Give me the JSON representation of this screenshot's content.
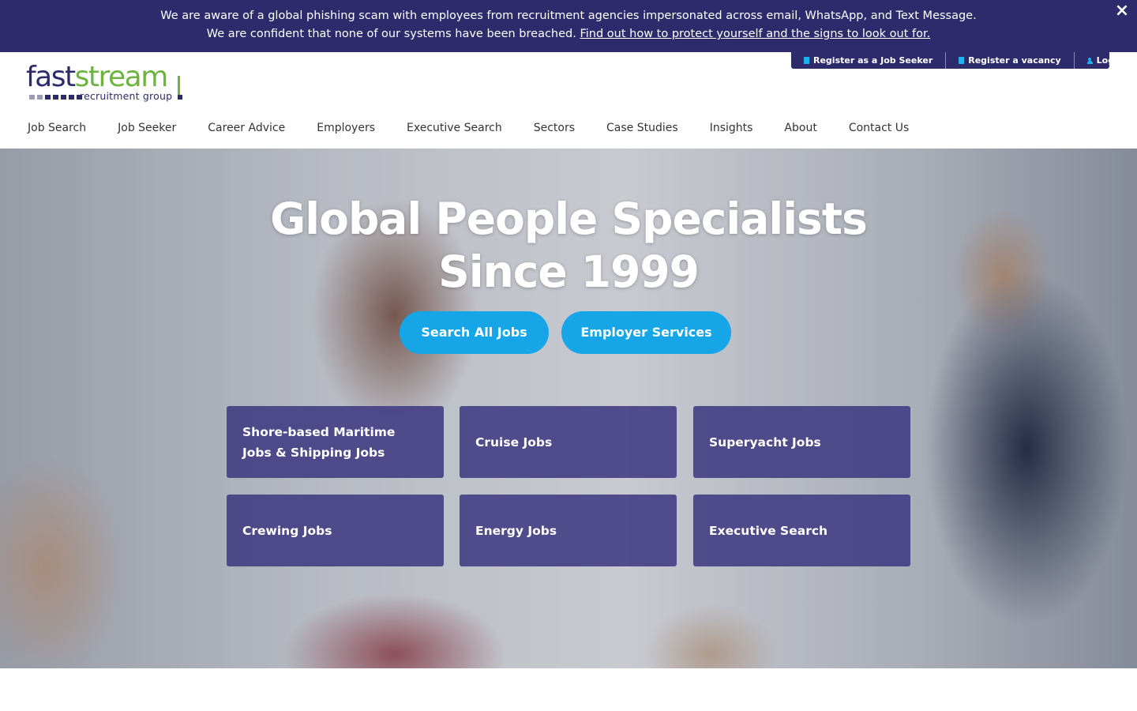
{
  "alert": {
    "line1": "We are aware of a global phishing scam with employees from recruitment agencies impersonated across email, WhatsApp, and Text Message.",
    "line2_text": "We are confident that none of our systems have been breached. ",
    "line2_link": "Find out how to protect yourself and the signs to look out for.",
    "close_icon": "×"
  },
  "logo": {
    "part1": "fast",
    "part2": "stream",
    "subtitle": "recruitment group",
    "colors": {
      "navy": "#2d2b6b",
      "green": "#6db33f"
    }
  },
  "utility_nav": [
    {
      "label": "Register as a Job Seeker",
      "icon": "document-icon"
    },
    {
      "label": "Register a vacancy",
      "icon": "document-icon"
    },
    {
      "label": "Login",
      "icon": "user-icon"
    }
  ],
  "main_nav": [
    "Job Search",
    "Job Seeker",
    "Career Advice",
    "Employers",
    "Executive Search",
    "Sectors",
    "Case Studies",
    "Insights",
    "About",
    "Contact Us"
  ],
  "hero": {
    "title_line1": "Global People Specialists",
    "title_line2": "Since 1999",
    "buttons": [
      "Search All Jobs",
      "Employer Services"
    ]
  },
  "tiles": [
    "Shore-based Maritime Jobs & Shipping Jobs",
    "Cruise Jobs",
    "Superyacht Jobs",
    "Crewing Jobs",
    "Energy Jobs",
    "Executive Search"
  ],
  "colors": {
    "banner": "#2d2b6b",
    "accent": "#16a6e8",
    "tile": "#403a82"
  }
}
